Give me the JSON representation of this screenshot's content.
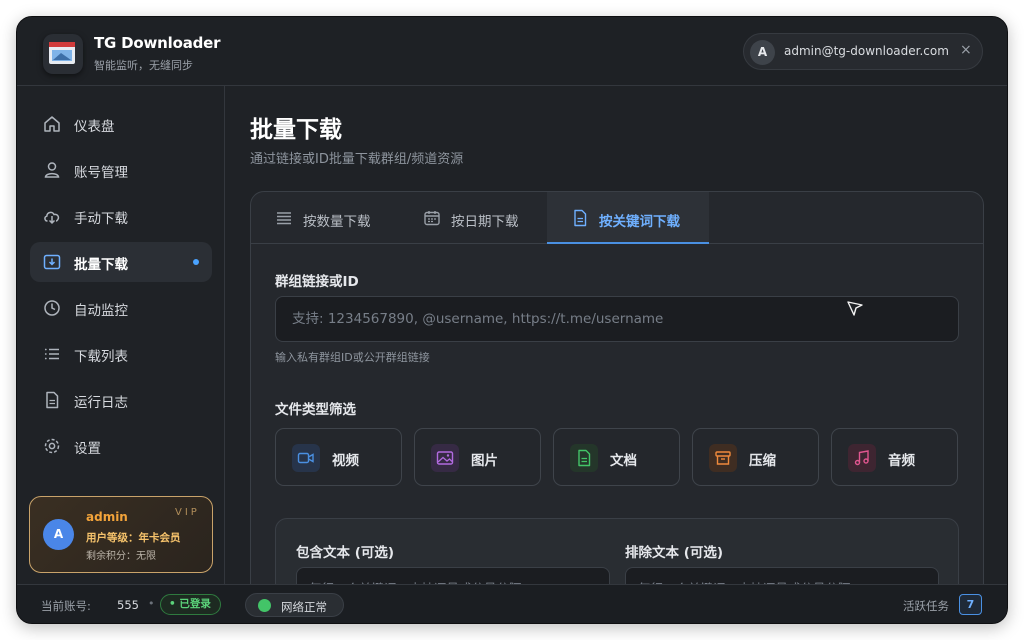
{
  "app": {
    "title": "TG Downloader",
    "subtitle": "智能监听，无缝同步"
  },
  "user": {
    "avatar_letter": "A",
    "email": "admin@tg-downloader.com",
    "close_glyph": "×"
  },
  "sidebar": {
    "items": [
      {
        "label": "仪表盘",
        "icon": "home-icon",
        "active": false
      },
      {
        "label": "账号管理",
        "icon": "user-icon",
        "active": false
      },
      {
        "label": "手动下载",
        "icon": "cloud-download-icon",
        "active": false
      },
      {
        "label": "批量下载",
        "icon": "batch-download-icon",
        "active": true
      },
      {
        "label": "自动监控",
        "icon": "clock-icon",
        "active": false
      },
      {
        "label": "下载列表",
        "icon": "list-icon",
        "active": false
      },
      {
        "label": "运行日志",
        "icon": "document-icon",
        "active": false
      },
      {
        "label": "设置",
        "icon": "gear-icon",
        "active": false
      }
    ]
  },
  "vip_card": {
    "avatar_letter": "A",
    "name": "admin",
    "tag": "VIP",
    "level": "用户等级：年卡会员",
    "points": "剩余积分：无限"
  },
  "main": {
    "title": "批量下载",
    "subtitle": "通过链接或ID批量下载群组/频道资源",
    "tabs": [
      {
        "label": "按数量下载",
        "icon": "stack-icon",
        "active": false
      },
      {
        "label": "按日期下载",
        "icon": "calendar-icon",
        "active": false
      },
      {
        "label": "按关键词下载",
        "icon": "file-text-icon",
        "active": true
      }
    ],
    "group_field": {
      "label": "群组链接或ID",
      "placeholder": "支持: 1234567890, @username, https://t.me/username",
      "value": "",
      "hint": "输入私有群组ID或公开群组链接"
    },
    "file_types": {
      "label": "文件类型筛选",
      "items": [
        {
          "label": "视频",
          "icon": "video-icon",
          "color": "#4a90e2"
        },
        {
          "label": "图片",
          "icon": "image-icon",
          "color": "#b26be0"
        },
        {
          "label": "文档",
          "icon": "document-icon",
          "color": "#43c468"
        },
        {
          "label": "压缩",
          "icon": "archive-icon",
          "color": "#f08a3c"
        },
        {
          "label": "音频",
          "icon": "music-icon",
          "color": "#e0568f"
        }
      ]
    },
    "text_filters": {
      "include_label": "包含文本 (可选)",
      "exclude_label": "排除文本 (可选)",
      "include_placeholder": "每行一个关键词，支持逗号或分号分隔",
      "exclude_placeholder": "每行一个关键词，支持逗号或分号分隔"
    }
  },
  "statusbar": {
    "account_label": "当前账号:",
    "account_value": "555",
    "separator": "•",
    "login_badge": "• 已登录",
    "network": "网络正常",
    "tasks_label": "活跃任务",
    "tasks_count": "7"
  },
  "colors": {
    "accent": "#4a90e2",
    "success": "#43c468",
    "vip_gold": "#f2a33a"
  }
}
